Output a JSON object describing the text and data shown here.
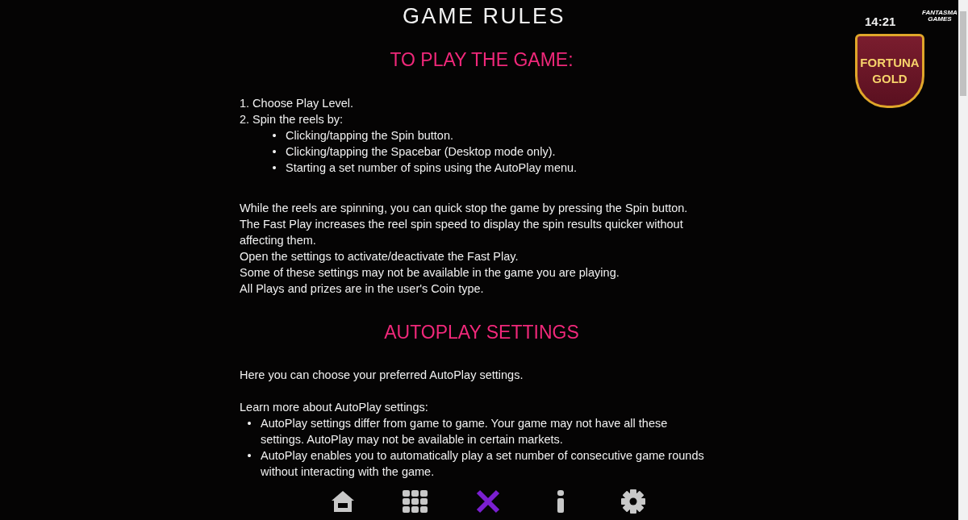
{
  "title": "GAME RULES",
  "clock": "14:21",
  "brand": {
    "studio": [
      "FANTASMA",
      "GAMES"
    ],
    "game_logo": [
      "FORTUNA",
      "GOLD"
    ]
  },
  "sections": [
    {
      "heading": "TO PLAY THE GAME:",
      "blocks": [
        {
          "kind": "list",
          "items": [
            {
              "marker": "1.",
              "text": "Choose Play Level."
            },
            {
              "marker": "2.",
              "text": "Spin the reels by:",
              "children": [
                {
                  "marker": "•",
                  "text": "Clicking/tapping the Spin button."
                },
                {
                  "marker": "•",
                  "text": "Clicking/tapping the Spacebar (Desktop mode only)."
                },
                {
                  "marker": "•",
                  "text": "Starting a set number of spins using the AutoPlay menu."
                }
              ]
            }
          ]
        },
        {
          "kind": "paragraph",
          "lines": [
            "While the reels are spinning, you can quick stop the game by pressing the Spin button.",
            "The Fast Play increases the reel spin speed to display the spin results quicker without affecting them.",
            "Open the settings to activate/deactivate the Fast Play.",
            "Some of these settings may not be available in the game you are playing.",
            "All Plays and prizes are in the user's Coin type."
          ]
        }
      ]
    },
    {
      "heading": "AUTOPLAY SETTINGS",
      "blocks": [
        {
          "kind": "paragraph",
          "lines": [
            "Here you can choose your preferred AutoPlay settings."
          ]
        },
        {
          "kind": "paragraph",
          "lines": [
            "Learn more about AutoPlay settings:"
          ]
        },
        {
          "kind": "bullets",
          "items": [
            {
              "marker": "•",
              "text": "AutoPlay settings differ from game to game. Your game may not have all these settings. AutoPlay may not be available in certain markets."
            },
            {
              "marker": "•",
              "text": "AutoPlay enables you to automatically play a set number of consecutive game rounds without interacting with the game."
            }
          ]
        }
      ]
    }
  ],
  "nav": [
    {
      "kind": "home",
      "selected": false
    },
    {
      "kind": "menu",
      "selected": false
    },
    {
      "kind": "close",
      "selected": true
    },
    {
      "kind": "info",
      "selected": false
    },
    {
      "kind": "settings",
      "selected": false
    }
  ]
}
